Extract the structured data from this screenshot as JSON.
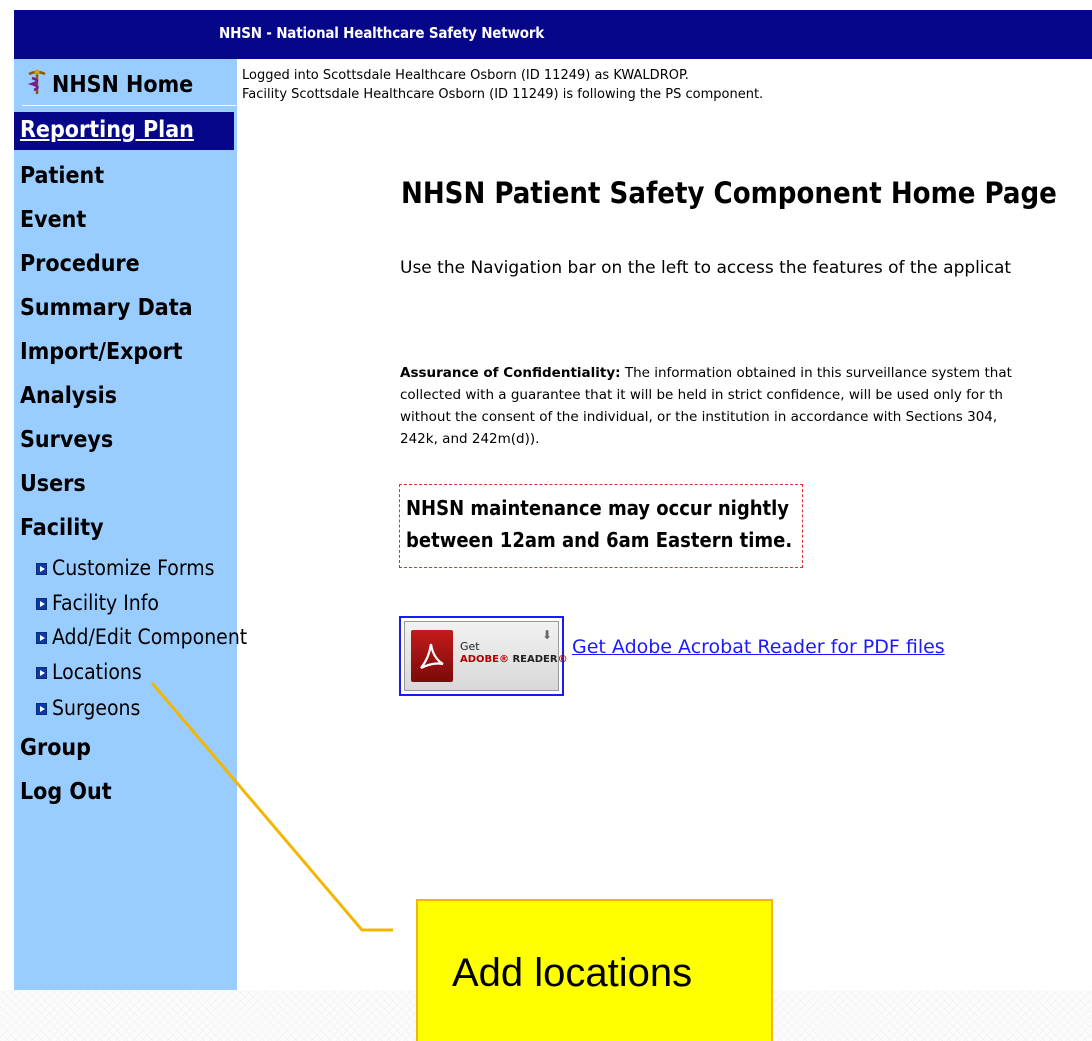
{
  "window": {
    "title": "NHSN - National Healthcare Safety Network"
  },
  "sidebar": {
    "home_label": "NHSN Home",
    "selected_label": "Reporting Plan",
    "items": [
      {
        "label": "Patient"
      },
      {
        "label": "Event"
      },
      {
        "label": "Procedure"
      },
      {
        "label": "Summary Data"
      },
      {
        "label": "Import/Export"
      },
      {
        "label": "Analysis"
      },
      {
        "label": "Surveys"
      },
      {
        "label": "Users"
      },
      {
        "label": "Facility"
      }
    ],
    "facility_subitems": [
      {
        "label": "Customize Forms"
      },
      {
        "label": "Facility Info"
      },
      {
        "label": "Add/Edit Component"
      },
      {
        "label": "Locations"
      },
      {
        "label": "Surgeons"
      }
    ],
    "bottom_items": [
      {
        "label": "Group"
      },
      {
        "label": "Log Out"
      }
    ]
  },
  "status": {
    "line1": "Logged into Scottsdale Healthcare Osborn (ID 11249) as KWALDROP.",
    "line2": "Facility Scottsdale Healthcare Osborn (ID 11249) is following the PS component."
  },
  "main": {
    "title": "NHSN Patient Safety Component Home Page",
    "intro": "Use the Navigation bar on the left to access the features of the applicat",
    "confidentiality_label": "Assurance of Confidentiality:",
    "confidentiality_lines": [
      " The information obtained in this surveillance system that",
      "collected with a guarantee that it will be held in strict confidence, will be used only for th",
      "without the consent of the individual, or the institution in accordance with Sections 304,",
      "242k, and 242m(d))."
    ],
    "maintenance_line1": "NHSN maintenance may occur nightly",
    "maintenance_line2": "between 12am and 6am Eastern time.",
    "adobe_get": "Get",
    "adobe_brand": "ADOBE",
    "adobe_reader": "READER",
    "adobe_link": "Get Adobe Acrobat Reader for PDF files"
  },
  "callout": {
    "text": "Add locations",
    "fill_color": "#ffff00",
    "line_color": "#f2b705"
  }
}
